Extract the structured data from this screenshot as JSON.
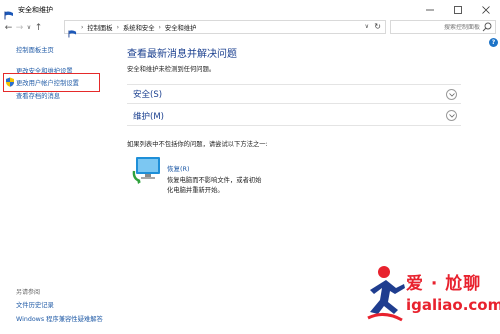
{
  "window": {
    "title": "安全和维护",
    "minimize_symbol": "—",
    "maximize_symbol": "☐",
    "close_symbol": "✕"
  },
  "nav": {
    "back": "←",
    "forward": "→",
    "recent": "∨",
    "up": "↑",
    "breadcrumbs": [
      "控制面板",
      "系统和安全",
      "安全和维护"
    ],
    "separator": "›",
    "dropdown": "∨",
    "refresh": "↻",
    "search_placeholder": "搜索控制面板"
  },
  "help_label": "?",
  "left_panel": {
    "home": "控制面板主页",
    "links": [
      "更改安全和维护设置",
      "更改用户帐户控制设置",
      "查看存档的消息"
    ],
    "see_also_title": "另请参阅",
    "see_also_links": [
      "文件历史记录",
      "Windows 程序兼容性疑难解答"
    ]
  },
  "main": {
    "title": "查看最新消息并解决问题",
    "subtitle": "安全和维护未检测到任何问题。",
    "sections": [
      "安全(S)",
      "维护(M)"
    ],
    "problem_text": "如果列表中不包括你的问题，请尝试以下方法之一:",
    "recovery": {
      "title": "恢复(R)",
      "desc_lines": [
        "恢复电脑而不影响文件，或者初始",
        "化电脑并重新开始。"
      ]
    }
  },
  "watermark": {
    "brand": "爱 · 尬聊",
    "domain": "igaliao.com"
  },
  "colors": {
    "link": "#1f5aa6",
    "heading": "#1a3f8f",
    "highlight": "#e52a2a",
    "watermark": "#e8222e"
  }
}
